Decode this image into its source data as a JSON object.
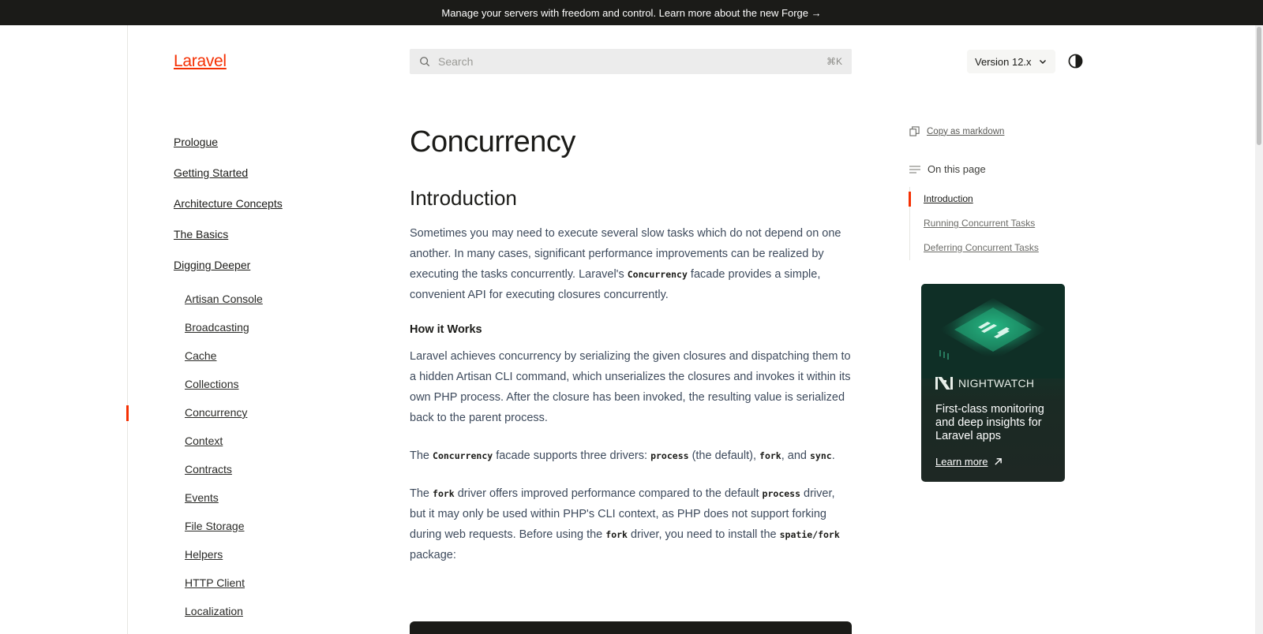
{
  "banner": {
    "text": "Manage your servers with freedom and control. Learn more about the new Forge →"
  },
  "header": {
    "logo": "Laravel",
    "search": {
      "placeholder": "Search",
      "shortcut": "⌘K"
    },
    "version": "Version 12.x"
  },
  "sidebar": {
    "sections": [
      "Prologue",
      "Getting Started",
      "Architecture Concepts",
      "The Basics",
      "Digging Deeper"
    ],
    "sub_items": [
      "Artisan Console",
      "Broadcasting",
      "Cache",
      "Collections",
      "Concurrency",
      "Context",
      "Contracts",
      "Events",
      "File Storage",
      "Helpers",
      "HTTP Client",
      "Localization"
    ],
    "active_item": "Concurrency"
  },
  "main": {
    "title": "Concurrency",
    "intro_heading": "Introduction",
    "p1": {
      "a": "Sometimes you may need to execute several slow tasks which do not depend on one another. In many cases, significant performance improvements can be realized by executing the tasks concurrently. Laravel's ",
      "code": "Concurrency",
      "b": " facade provides a simple, convenient API for executing closures concurrently."
    },
    "how_heading": "How it Works",
    "p2": "Laravel achieves concurrency by serializing the given closures and dispatching them to a hidden Artisan CLI command, which unserializes the closures and invokes it within its own PHP process. After the closure has been invoked, the resulting value is serialized back to the parent process.",
    "p3": {
      "a": "The ",
      "code1": "Concurrency",
      "b": " facade supports three drivers: ",
      "code2": "process",
      "c": " (the default), ",
      "code3": "fork",
      "d": ", and ",
      "code4": "sync",
      "e": "."
    },
    "p4": {
      "a": "The ",
      "code1": "fork",
      "b": " driver offers improved performance compared to the default ",
      "code2": "process",
      "c": " driver, but it may only be used within PHP's CLI context, as PHP does not support forking during web requests. Before using the ",
      "code3": "fork",
      "d": " driver, you need to install the ",
      "code4": "spatie/fork",
      "e": " package:"
    }
  },
  "right": {
    "copy_markdown": "Copy as markdown",
    "on_this_page": "On this page",
    "toc": [
      "Introduction",
      "Running Concurrent Tasks",
      "Deferring Concurrent Tasks"
    ],
    "ad": {
      "brand": "NIGHTWATCH",
      "text": "First-class monitoring and deep insights for Laravel apps",
      "link": "Learn more"
    }
  },
  "colors": {
    "accent": "#f53003",
    "banner_bg": "#1b1b18",
    "body_text": "#3d4a5c"
  }
}
